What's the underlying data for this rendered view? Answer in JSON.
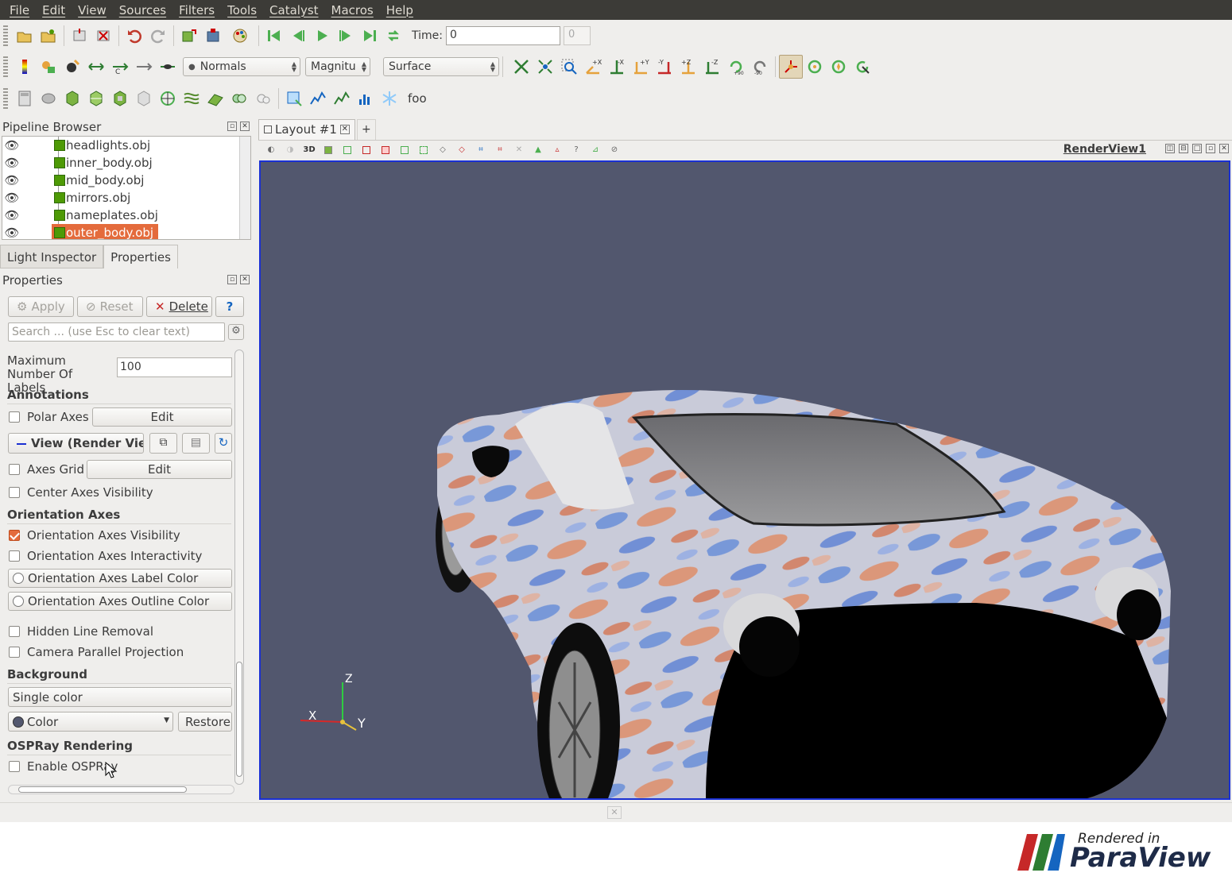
{
  "menu": [
    "File",
    "Edit",
    "View",
    "Sources",
    "Filters",
    "Tools",
    "Catalyst",
    "Macros",
    "Help"
  ],
  "toolbar": {
    "time_label": "Time:",
    "time_value": "0",
    "time_index": "0",
    "array_combo": "Normals",
    "component_combo": "Magnitu",
    "representation_combo": "Surface",
    "custom_label": "foo"
  },
  "pipeline": {
    "title": "Pipeline Browser",
    "items": [
      "headlights.obj",
      "inner_body.obj",
      "mid_body.obj",
      "mirrors.obj",
      "nameplates.obj",
      "outer_body.obj"
    ],
    "selected": "outer_body.obj"
  },
  "tabs": [
    "Light Inspector",
    "Properties"
  ],
  "properties": {
    "title": "Properties",
    "apply": "Apply",
    "reset": "Reset",
    "delete": "Delete",
    "help": "?",
    "search_placeholder": "Search ... (use Esc to clear text)",
    "max_labels_label": "Maximum Number Of Labels",
    "max_labels_value": "100",
    "annotations": "Annotations",
    "polar_axes": "Polar Axes",
    "edit": "Edit",
    "view_section": "View (Render View",
    "axes_grid": "Axes Grid",
    "center_axes": "Center Axes Visibility",
    "orientation_axes": "Orientation Axes",
    "oa_visibility": "Orientation Axes Visibility",
    "oa_interactivity": "Orientation Axes Interactivity",
    "oa_label_color": "Orientation Axes Label Color",
    "oa_outline_color": "Orientation Axes Outline Color",
    "hidden_line": "Hidden Line Removal",
    "parallel_projection": "Camera Parallel Projection",
    "background": "Background",
    "background_mode": "Single color",
    "color": "Color",
    "restore": "Restore I",
    "ospray": "OSPRay Rendering",
    "enable_ospray": "Enable OSPRay"
  },
  "layout": {
    "tab": "Layout #1",
    "add": "+",
    "view_name": "RenderView1",
    "view_3d": "3D"
  },
  "axes": {
    "x": "X",
    "y": "Y",
    "z": "Z"
  },
  "logo": {
    "small": "Rendered in",
    "big": "ParaView"
  },
  "colors": {
    "render_bg": "#52576e",
    "accent": "#e46b3c",
    "menubar": "#3c3b37"
  }
}
